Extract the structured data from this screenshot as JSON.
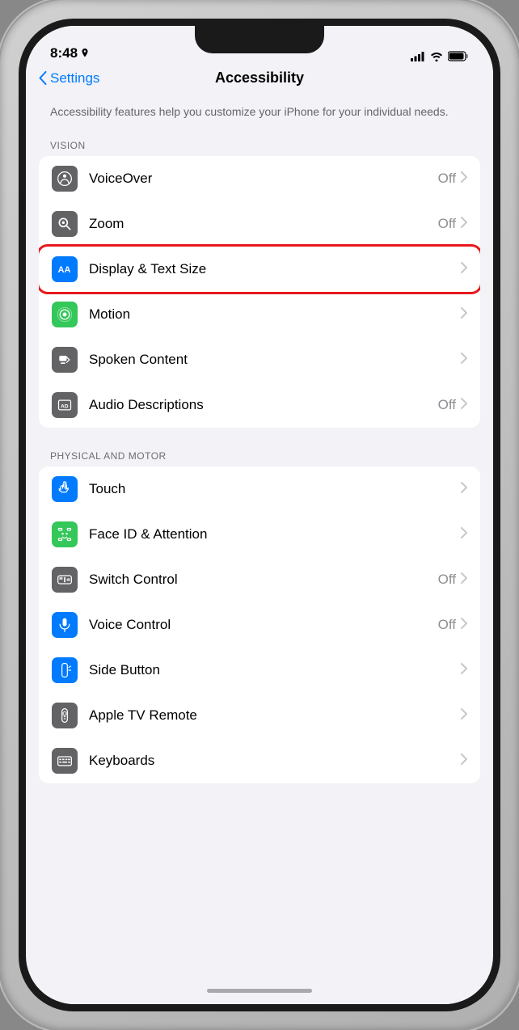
{
  "statusBar": {
    "time": "8:48",
    "locationIcon": "location-arrow"
  },
  "header": {
    "backLabel": "Settings",
    "title": "Accessibility"
  },
  "description": "Accessibility features help you customize your iPhone for your individual needs.",
  "sections": [
    {
      "id": "vision",
      "header": "VISION",
      "rows": [
        {
          "id": "voiceover",
          "label": "VoiceOver",
          "value": "Off",
          "iconBg": "gray",
          "highlighted": false
        },
        {
          "id": "zoom",
          "label": "Zoom",
          "value": "Off",
          "iconBg": "gray",
          "highlighted": false
        },
        {
          "id": "display-text-size",
          "label": "Display & Text Size",
          "value": "",
          "iconBg": "blue",
          "highlighted": true
        },
        {
          "id": "motion",
          "label": "Motion",
          "value": "",
          "iconBg": "green",
          "highlighted": false
        },
        {
          "id": "spoken-content",
          "label": "Spoken Content",
          "value": "",
          "iconBg": "gray",
          "highlighted": false
        },
        {
          "id": "audio-descriptions",
          "label": "Audio Descriptions",
          "value": "Off",
          "iconBg": "gray",
          "highlighted": false
        }
      ]
    },
    {
      "id": "physical-motor",
      "header": "PHYSICAL AND MOTOR",
      "rows": [
        {
          "id": "touch",
          "label": "Touch",
          "value": "",
          "iconBg": "blue",
          "highlighted": false
        },
        {
          "id": "face-id-attention",
          "label": "Face ID & Attention",
          "value": "",
          "iconBg": "green",
          "highlighted": false
        },
        {
          "id": "switch-control",
          "label": "Switch Control",
          "value": "Off",
          "iconBg": "gray",
          "highlighted": false
        },
        {
          "id": "voice-control",
          "label": "Voice Control",
          "value": "Off",
          "iconBg": "blue",
          "highlighted": false
        },
        {
          "id": "side-button",
          "label": "Side Button",
          "value": "",
          "iconBg": "blue",
          "highlighted": false
        },
        {
          "id": "apple-tv-remote",
          "label": "Apple TV Remote",
          "value": "",
          "iconBg": "gray",
          "highlighted": false
        },
        {
          "id": "keyboards",
          "label": "Keyboards",
          "value": "",
          "iconBg": "gray",
          "highlighted": false
        }
      ]
    }
  ]
}
